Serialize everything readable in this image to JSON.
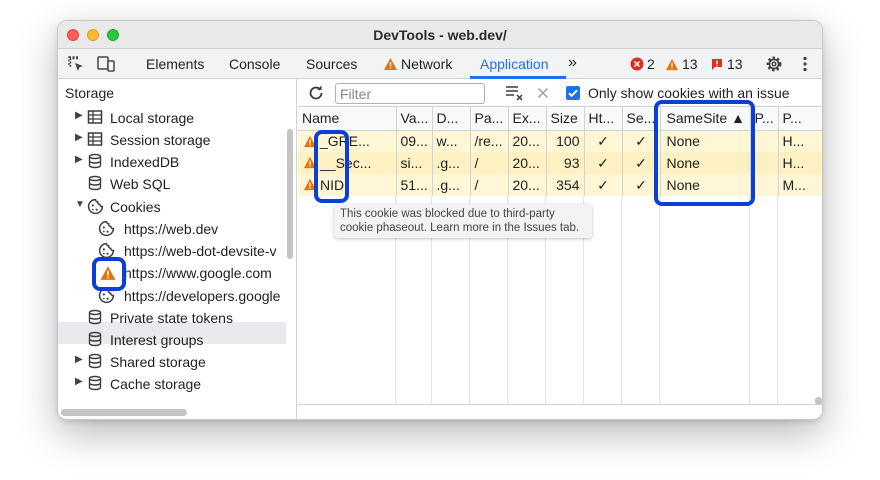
{
  "window": {
    "title": "DevTools - web.dev/"
  },
  "toolbar": {
    "tabs": [
      "Elements",
      "Console",
      "Sources",
      "Network",
      "Application"
    ],
    "more": "»",
    "errors_count": "2",
    "warnings_count": "13",
    "issues_count": "13"
  },
  "sidebar": {
    "header": "Storage",
    "items": [
      "Local storage",
      "Session storage",
      "IndexedDB",
      "Web SQL",
      "Cookies",
      "https://web.dev",
      "https://web-dot-devsite-v",
      "https://www.google.com",
      "https://developers.google",
      "Private state tokens",
      "Interest groups",
      "Shared storage",
      "Cache storage"
    ]
  },
  "filter": {
    "placeholder": "Filter",
    "only_issues_label": "Only show cookies with an issue"
  },
  "table": {
    "columns": [
      "Name",
      "Va...",
      "D...",
      "Pa...",
      "Ex...",
      "Size",
      "Ht...",
      "Se...",
      "SameSite ▲",
      "P...",
      "P..."
    ],
    "rows": [
      [
        "_GRE...",
        "09...",
        "w...",
        "/re...",
        "20...",
        "100",
        "✓",
        "✓",
        "None",
        "",
        "H..."
      ],
      [
        "__Sec...",
        "si...",
        ".g...",
        "/",
        "20...",
        "93",
        "✓",
        "✓",
        "None",
        "",
        "H..."
      ],
      [
        "NID",
        "51...",
        ".g...",
        "/",
        "20...",
        "354",
        "✓",
        "✓",
        "None",
        "",
        "M..."
      ]
    ]
  },
  "tooltip": {
    "line1": "This cookie was blocked due to third-party",
    "line2": "cookie phaseout. Learn more in the Issues tab."
  },
  "colors": {
    "accent": "#1a73e8",
    "warning": "#e8710a",
    "highlight": "#0b3fd6"
  }
}
